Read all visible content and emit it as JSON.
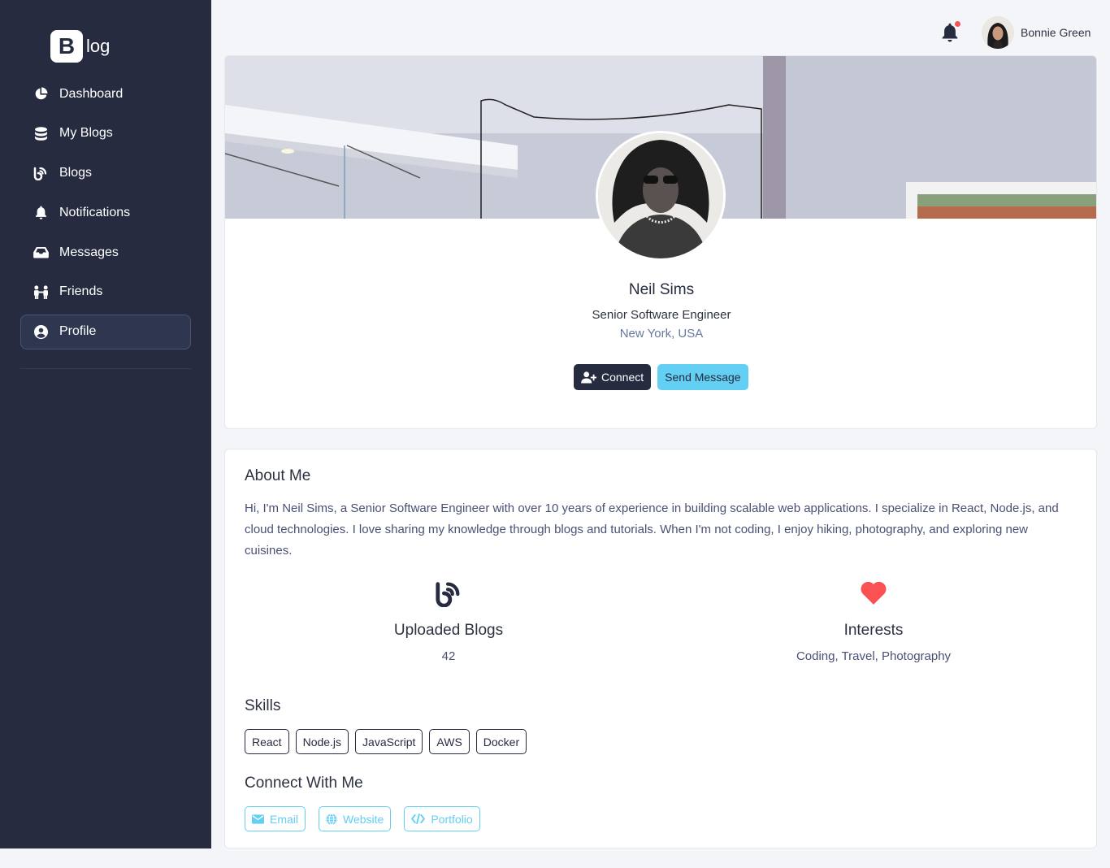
{
  "brand": {
    "logo_letter": "B",
    "logo_text": "log"
  },
  "sidebar": {
    "items": [
      {
        "label": "Dashboard",
        "icon": "chart-pie-icon"
      },
      {
        "label": "My Blogs",
        "icon": "database-icon"
      },
      {
        "label": "Blogs",
        "icon": "blog-icon"
      },
      {
        "label": "Notifications",
        "icon": "bell-icon"
      },
      {
        "label": "Messages",
        "icon": "inbox-icon"
      },
      {
        "label": "Friends",
        "icon": "people-icon"
      },
      {
        "label": "Profile",
        "icon": "user-circle-icon",
        "active": true
      }
    ]
  },
  "topbar": {
    "user_name": "Bonnie Green",
    "has_notification": true
  },
  "profile": {
    "name": "Neil Sims",
    "role": "Senior Software Engineer",
    "location": "New York, USA",
    "connect_label": "Connect",
    "message_label": "Send Message"
  },
  "about": {
    "heading": "About Me",
    "text": "Hi, I'm Neil Sims, a Senior Software Engineer with over 10 years of experience in building scalable web applications. I specialize in React, Node.js, and cloud technologies. I love sharing my knowledge through blogs and tutorials. When I'm not coding, I enjoy hiking, photography, and exploring new cuisines.",
    "stats": [
      {
        "title": "Uploaded Blogs",
        "value": "42",
        "icon": "blog-icon"
      },
      {
        "title": "Interests",
        "value": "Coding, Travel, Photography",
        "icon": "heart-icon"
      }
    ]
  },
  "skills": {
    "heading": "Skills",
    "items": [
      "React",
      "Node.js",
      "JavaScript",
      "AWS",
      "Docker"
    ]
  },
  "connect": {
    "heading": "Connect With Me",
    "links": [
      {
        "label": "Email",
        "icon": "envelope-icon"
      },
      {
        "label": "Website",
        "icon": "globe-icon"
      },
      {
        "label": "Portfolio",
        "icon": "code-icon"
      }
    ]
  },
  "colors": {
    "sidebar": "#262b40",
    "accent": "#63cff3",
    "heart": "#fa5252",
    "background": "#f3f5f8"
  }
}
